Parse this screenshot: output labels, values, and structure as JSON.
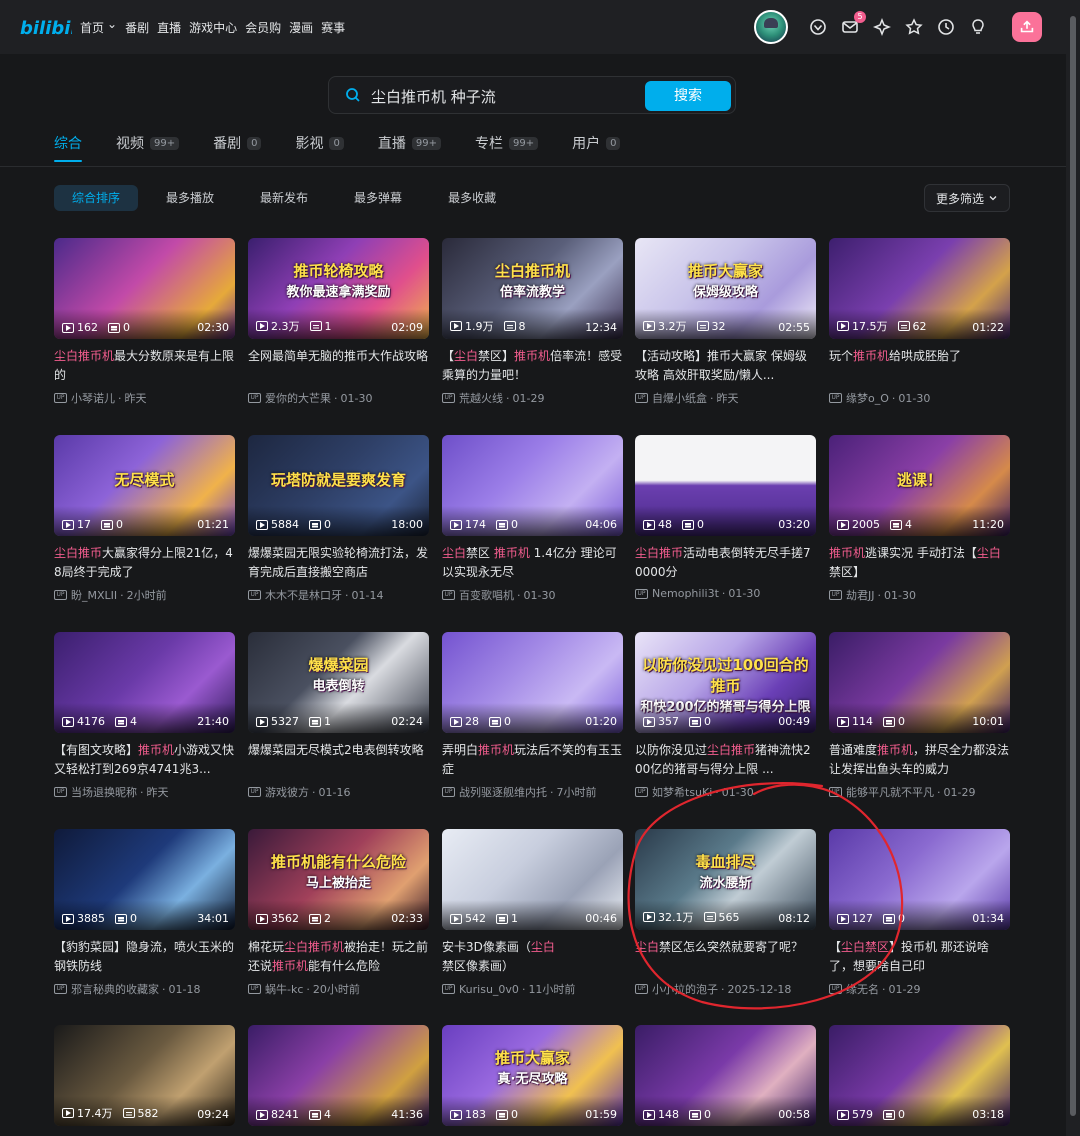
{
  "nav": {
    "links": [
      "首页",
      "番剧",
      "直播",
      "游戏中心",
      "会员购",
      "漫画",
      "赛事"
    ],
    "message_badge": "5"
  },
  "search": {
    "query": "尘白推币机 种子流",
    "button": "搜索"
  },
  "tabs": [
    {
      "label": "综合",
      "count": ""
    },
    {
      "label": "视频",
      "count": "99+"
    },
    {
      "label": "番剧",
      "count": "0"
    },
    {
      "label": "影视",
      "count": "0"
    },
    {
      "label": "直播",
      "count": "99+"
    },
    {
      "label": "专栏",
      "count": "99+"
    },
    {
      "label": "用户",
      "count": "0"
    }
  ],
  "filters": [
    "综合排序",
    "最多播放",
    "最新发布",
    "最多弹幕",
    "最多收藏"
  ],
  "more_filter": "更多筛选",
  "colors": {
    "accent": "#00aeec",
    "highlight": "#f25d8e",
    "upload": "#fb7299"
  },
  "videos": [
    {
      "plays": "162",
      "danmaku": "0",
      "duration": "02:30",
      "title": [
        [
          "尘白推币机",
          true
        ],
        [
          "最大分数原来是有上限的",
          false
        ]
      ],
      "author": "小琴诺儿",
      "date": "昨天",
      "overlay": "",
      "bg": "linear-gradient(135deg,#4b2a8a 0%,#c24aa8 45%,#e6a93a 80%,#6b2f8f 100%)"
    },
    {
      "plays": "2.3万",
      "danmaku": "1",
      "duration": "02:09",
      "title": [
        [
          "全网最简单无脑的推币大作战攻略",
          false
        ]
      ],
      "author": "爱你的大芒果",
      "date": "01-30",
      "overlay": "推币轮椅攻略|教你最速拿满奖励",
      "bg": "linear-gradient(135deg,#3a1f6e 0%,#8f3fb5 40%,#e04f8c 70%,#f0b64a 100%)"
    },
    {
      "plays": "1.9万",
      "danmaku": "8",
      "duration": "12:34",
      "title": [
        [
          "【",
          false
        ],
        [
          "尘白",
          true
        ],
        [
          "禁区】",
          false
        ],
        [
          "推币机",
          true
        ],
        [
          "倍率流！感受乘算的力量吧！",
          false
        ]
      ],
      "author": "荒越火线",
      "date": "01-29",
      "overlay": "尘白推币机|倍率流教学",
      "bg": "linear-gradient(135deg,#2a2a3a 0%,#5a5f7a 45%,#9aa0c0 70%,#3b3050 100%)"
    },
    {
      "plays": "3.2万",
      "danmaku": "32",
      "duration": "02:55",
      "title": [
        [
          "【活动攻略】推币大赢家 保姆级攻略 高效肝取奖励/懒人...",
          false
        ]
      ],
      "author": "自爆小纸盒",
      "date": "昨天",
      "overlay": "推币大赢家|保姆级攻略",
      "bg": "linear-gradient(135deg,#e8e6f5 0%,#c9c4ea 40%,#a99bdc 70%,#f2eef8 100%)"
    },
    {
      "plays": "17.5万",
      "danmaku": "62",
      "duration": "01:22",
      "title": [
        [
          "玩个",
          false
        ],
        [
          "推币机",
          true
        ],
        [
          "给哄成胚胎了",
          false
        ]
      ],
      "author": "缘梦o_O",
      "date": "01-30",
      "overlay": "",
      "bg": "linear-gradient(135deg,#3d1f6e 0%,#7a3fae 45%,#d4a24a 75%,#4a2a7a 100%)"
    },
    {
      "plays": "17",
      "danmaku": "0",
      "duration": "01:21",
      "title": [
        [
          "尘白推币",
          true
        ],
        [
          "大赢家得分上限21亿，48局终于完成了",
          false
        ]
      ],
      "author": "盼_MXLII",
      "date": "2小时前",
      "overlay": "无尽模式",
      "bg": "linear-gradient(135deg,#5a3aa8 0%,#8d63d8 40%,#f0b24a 75%,#6f45c2 100%)"
    },
    {
      "plays": "5884",
      "danmaku": "0",
      "duration": "18:00",
      "title": [
        [
          "爆爆菜园无限实验轮椅流打法，发育完成后直接搬空商店",
          false
        ]
      ],
      "author": "木木不是林口牙",
      "date": "01-14",
      "overlay": "玩塔防就是要爽发育",
      "bg": "linear-gradient(135deg,#1d2740 0%,#2e3f66 45%,#3c5486 75%,#1b2438 100%)"
    },
    {
      "plays": "174",
      "danmaku": "0",
      "duration": "04:06",
      "title": [
        [
          "尘白",
          true
        ],
        [
          "禁区 ",
          false
        ],
        [
          "推币机",
          true
        ],
        [
          " 1.4亿分 理论可以实现永无尽",
          false
        ]
      ],
      "author": "百变歌唱机",
      "date": "01-30",
      "overlay": "",
      "bg": "linear-gradient(135deg,#6e4fc9 0%,#9b7ee8 40%,#c3b0f2 70%,#7a5ad6 100%)"
    },
    {
      "plays": "48",
      "danmaku": "0",
      "duration": "03:20",
      "title": [
        [
          "尘白推币",
          true
        ],
        [
          "活动电表倒转无尽手搓70000分",
          false
        ]
      ],
      "author": "Nemophili3t",
      "date": "01-30",
      "overlay": "",
      "bg": "linear-gradient(180deg,#f4f4f6 0%,#f4f4f6 45%,#6b3fb0 50%,#4a2a88 100%)"
    },
    {
      "plays": "2005",
      "danmaku": "4",
      "duration": "11:20",
      "title": [
        [
          "推币机",
          true
        ],
        [
          "逃课实况 手动打法【",
          false
        ],
        [
          "尘白",
          true
        ],
        [
          "禁区】",
          false
        ]
      ],
      "author": "劫君JJ",
      "date": "01-30",
      "overlay": "逃课！",
      "bg": "linear-gradient(135deg,#4a2178 0%,#8a3fa6 45%,#d58a4a 75%,#3a1d66 100%)"
    },
    {
      "plays": "4176",
      "danmaku": "4",
      "duration": "21:40",
      "title": [
        [
          "【有图文攻略】",
          false
        ],
        [
          "推币机",
          true
        ],
        [
          "小游戏又快又轻松打到269京4741兆3...",
          false
        ]
      ],
      "author": "当场退换昵称",
      "date": "昨天",
      "overlay": "",
      "bg": "linear-gradient(135deg,#3b1f6e 0%,#6a3aa8 45%,#9a5ad0 70%,#2f1a5a 100%)"
    },
    {
      "plays": "5327",
      "danmaku": "1",
      "duration": "02:24",
      "title": [
        [
          "爆爆菜园无尽模式2电表倒转攻略",
          false
        ]
      ],
      "author": "游戏彼方",
      "date": "01-16",
      "overlay": "爆爆菜园|电表倒转",
      "bg": "linear-gradient(135deg,#2a2e3a 0%,#4a5060 40%,#d9dbe0 60%,#3a3f4c 100%)"
    },
    {
      "plays": "28",
      "danmaku": "0",
      "duration": "01:20",
      "title": [
        [
          "弄明白",
          false
        ],
        [
          "推币机",
          true
        ],
        [
          "玩法后不笑的有玉玉症",
          false
        ]
      ],
      "author": "战列驱逐舰维内托",
      "date": "7小时前",
      "overlay": "",
      "bg": "linear-gradient(135deg,#7453d0 0%,#a38ae6 40%,#c9b9f4 70%,#7a5cd8 100%)"
    },
    {
      "plays": "357",
      "danmaku": "0",
      "duration": "00:49",
      "title": [
        [
          "以防你没见过",
          false
        ],
        [
          "尘白推币",
          true
        ],
        [
          "猪神流快200亿的猪哥与得分上限 ...",
          false
        ]
      ],
      "author": "如梦希tsuKi",
      "date": "01-30",
      "overlay": "以防你没见过100回合的推币|和快200亿的猪哥与得分上限",
      "bg": "linear-gradient(135deg,#e9e4f7 0%,#b8a6e8 40%,#6a3fb6 70%,#3a2070 100%)"
    },
    {
      "plays": "114",
      "danmaku": "0",
      "duration": "10:01",
      "title": [
        [
          "普通难度",
          false
        ],
        [
          "推币机",
          true
        ],
        [
          "，拼尽全力都没法让发挥出鱼头车的威力",
          false
        ]
      ],
      "author": "能够平凡就不平凡",
      "date": "01-29",
      "overlay": "",
      "bg": "linear-gradient(135deg,#3a1d66 0%,#7a3aa0 45%,#d0a050 75%,#3a1d66 100%)"
    },
    {
      "plays": "3885",
      "danmaku": "0",
      "duration": "34:01",
      "title": [
        [
          "【豹豹菜园】隐身流，喷火玉米的钢铁防线",
          false
        ]
      ],
      "author": "邪言秘典的收藏家",
      "date": "01-18",
      "overlay": "",
      "bg": "linear-gradient(135deg,#0f1a3a 0%,#1e3a7a 45%,#7ab0e0 70%,#0d1830 100%)"
    },
    {
      "plays": "3562",
      "danmaku": "2",
      "duration": "02:33",
      "title": [
        [
          "棉花玩",
          false
        ],
        [
          "尘白推币机",
          true
        ],
        [
          "被抬走！玩之前还说",
          false
        ],
        [
          "推币机",
          true
        ],
        [
          "能有什么危险",
          false
        ]
      ],
      "author": "蜗牛-kc",
      "date": "20小时前",
      "overlay": "推币机能有什么危险|马上被抬走",
      "bg": "linear-gradient(135deg,#3a1a3a 0%,#a0405a 45%,#e0a070 75%,#3a1a2a 100%)"
    },
    {
      "plays": "542",
      "danmaku": "1",
      "duration": "00:46",
      "title": [
        [
          "安卡3D像素画（",
          false
        ],
        [
          "尘白",
          true
        ],
        [
          "禁区像素画）",
          false
        ]
      ],
      "author": "Kurisu_0v0",
      "date": "11小时前",
      "overlay": "",
      "bg": "linear-gradient(135deg,#e8ecf4 0%,#c8cede 40%,#9aa2b6 70%,#eef1f6 100%)"
    },
    {
      "plays": "32.1万",
      "danmaku": "565",
      "duration": "08:12",
      "title": [
        [
          "尘白",
          true
        ],
        [
          "禁区怎么突然就要寄了呢？",
          false
        ]
      ],
      "author": "小小拉的泡子",
      "date": "2025-12-18",
      "overlay": "毒血排尽|流水腰斩",
      "bg": "linear-gradient(135deg,#2a3a4a 0%,#5a7a8a 40%,#c0ccd4 60%,#3a4a5a 100%)"
    },
    {
      "plays": "127",
      "danmaku": "0",
      "duration": "01:34",
      "title": [
        [
          "【",
          false
        ],
        [
          "尘白禁区",
          true
        ],
        [
          "】投币机 那还说啥了，想要啥自己印",
          false
        ]
      ],
      "author": "缘无名",
      "date": "01-29",
      "overlay": "",
      "bg": "linear-gradient(135deg,#5a3aa8 0%,#8a6ad0 40%,#b9a6ec 70%,#5a3aa8 100%)"
    },
    {
      "plays": "17.4万",
      "danmaku": "582",
      "duration": "09:24",
      "title": [
        [
          "",
          false
        ]
      ],
      "author": "",
      "date": "",
      "overlay": "",
      "bg": "linear-gradient(135deg,#1a1a1a 0%,#6a5a40 45%,#c0a070 70%,#2a2218 100%)"
    },
    {
      "plays": "8241",
      "danmaku": "4",
      "duration": "41:36",
      "title": [
        [
          "",
          false
        ]
      ],
      "author": "",
      "date": "",
      "overlay": "",
      "bg": "linear-gradient(135deg,#3a1d66 0%,#8a3fa6 40%,#d0a040 75%,#3a1d66 100%)"
    },
    {
      "plays": "183",
      "danmaku": "0",
      "duration": "01:59",
      "title": [
        [
          "",
          false
        ]
      ],
      "author": "",
      "date": "",
      "overlay": "推币大赢家|真·无尽攻略",
      "bg": "linear-gradient(135deg,#6a3fc0 0%,#9a6ae0 40%,#f0c050 70%,#5a30a8 100%)"
    },
    {
      "plays": "148",
      "danmaku": "0",
      "duration": "00:58",
      "title": [
        [
          "",
          false
        ]
      ],
      "author": "",
      "date": "",
      "overlay": "",
      "bg": "linear-gradient(135deg,#3a1d66 0%,#7a3aa8 45%,#e0b0c0 70%,#3a1d66 100%)"
    },
    {
      "plays": "579",
      "danmaku": "0",
      "duration": "03:18",
      "title": [
        [
          "",
          false
        ]
      ],
      "author": "",
      "date": "",
      "overlay": "",
      "bg": "linear-gradient(135deg,#3a1d66 0%,#7a3aa8 45%,#e0c050 70%,#3a1d66 100%)"
    }
  ]
}
